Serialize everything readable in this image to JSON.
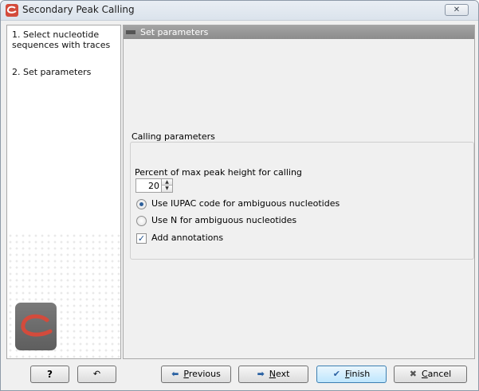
{
  "window": {
    "title": "Secondary Peak Calling",
    "close_icon": "close-x-icon"
  },
  "wizard_steps": [
    {
      "number": "1.",
      "label": "Select nucleotide sequences with traces"
    },
    {
      "number": "2.",
      "label": "Set parameters"
    }
  ],
  "panel": {
    "header": "Set parameters",
    "group_title": "Calling parameters",
    "percent_label": "Percent of max peak height for calling",
    "percent_value": "20",
    "radio_options": [
      {
        "label": "Use IUPAC code for ambiguous nucleotides",
        "checked": true
      },
      {
        "label": "Use N for ambiguous nucleotides",
        "checked": false
      }
    ],
    "add_annotations": {
      "label": "Add annotations",
      "checked": true
    }
  },
  "buttons": {
    "help": "?",
    "previous": {
      "prefix": "",
      "mnemonic": "P",
      "rest": "revious"
    },
    "next": {
      "prefix": "",
      "mnemonic": "N",
      "rest": "ext"
    },
    "finish": {
      "prefix": "",
      "mnemonic": "F",
      "rest": "inish"
    },
    "cancel": {
      "prefix": "",
      "mnemonic": "C",
      "rest": "ancel"
    }
  },
  "colors": {
    "accent": "#2b62a3",
    "header_bar": "#999999",
    "logo_red": "#d34b3c"
  }
}
